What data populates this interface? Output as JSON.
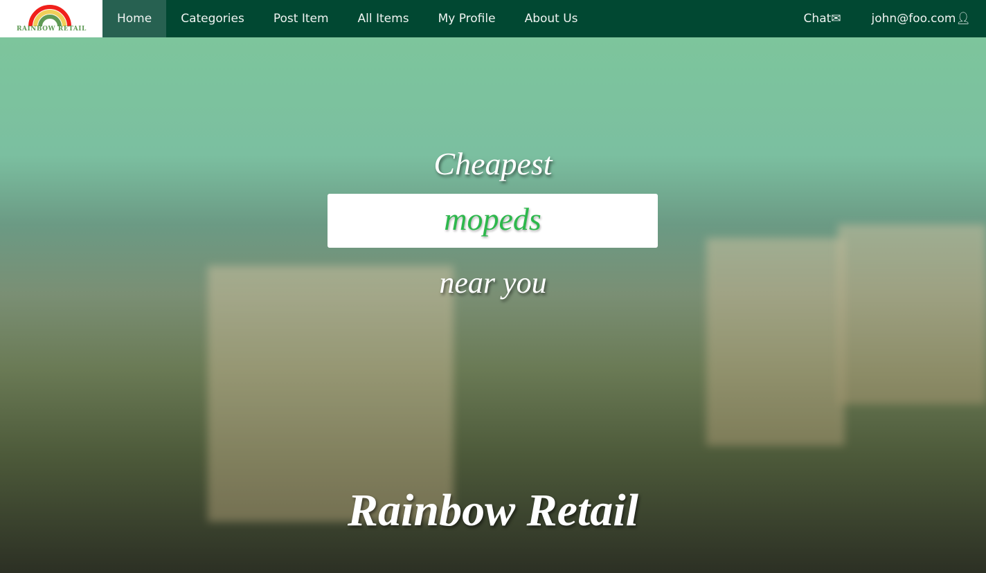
{
  "nav": {
    "logo_text": "RAINBOW RETAIL",
    "items": [
      "Home",
      "Categories",
      "Post Item",
      "All Items",
      "My Profile",
      "About Us"
    ],
    "chat": "Chat",
    "user": "john@foo.com"
  },
  "hero": {
    "line1": "Cheapest",
    "word": "mopeds",
    "line2": "near you",
    "title": "Rainbow Retail"
  }
}
